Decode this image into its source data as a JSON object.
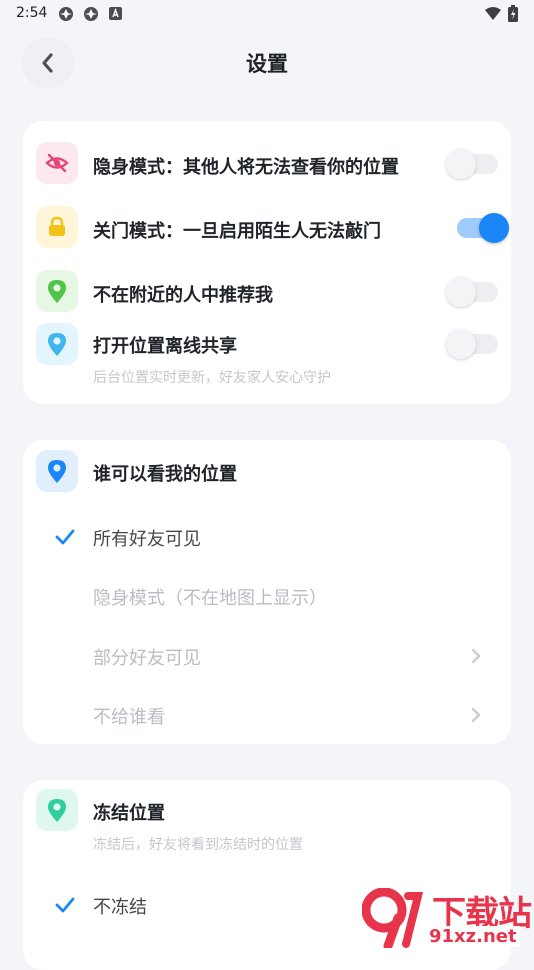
{
  "status_bar": {
    "time": "2:54",
    "icons": [
      "app-icon",
      "app-icon",
      "notification-icon",
      "wifi-icon",
      "battery-icon"
    ]
  },
  "header": {
    "title": "设置",
    "back_icon": "chevron-left-icon"
  },
  "privacy_card": {
    "items": [
      {
        "label": "隐身模式：其他人将无法查看你的位置",
        "icon": "eye-off-icon",
        "icon_color": "#e5457a",
        "icon_bg": "#fde8f0",
        "enabled": false
      },
      {
        "label": "关门模式：一旦启用陌生人无法敲门",
        "icon": "lock-icon",
        "icon_color": "#f2c21b",
        "icon_bg": "#fff6d9",
        "enabled": true
      },
      {
        "label": "不在附近的人中推荐我",
        "icon": "location-pin-icon",
        "icon_color": "#52c44a",
        "icon_bg": "#e6f8e4",
        "enabled": false
      },
      {
        "label": "打开位置离线共享",
        "sublabel": "后台位置实时更新，好友家人安心守护",
        "icon": "location-pin-icon",
        "icon_color": "#3fb6ee",
        "icon_bg": "#e3f5fd",
        "enabled": false
      }
    ]
  },
  "visibility_card": {
    "title": "谁可以看我的位置",
    "icon": "location-pin-icon",
    "icon_color": "#1a86f7",
    "icon_bg": "#e1eefc",
    "options": [
      {
        "label": "所有好友可见",
        "selected": true,
        "has_arrow": false
      },
      {
        "label": "隐身模式（不在地图上显示）",
        "selected": false,
        "has_arrow": false
      },
      {
        "label": "部分好友可见",
        "selected": false,
        "has_arrow": true
      },
      {
        "label": "不给谁看",
        "selected": false,
        "has_arrow": true
      }
    ]
  },
  "freeze_card": {
    "title": "冻结位置",
    "subtitle": "冻结后，好友将看到冻结时的位置",
    "icon": "location-pin-icon",
    "icon_color": "#2fcf9b",
    "icon_bg": "#e0f7ef",
    "options": [
      {
        "label": "不冻结",
        "selected": true
      }
    ]
  },
  "watermark": {
    "top": "下载站",
    "bottom": "91xz.net"
  },
  "colors": {
    "accent": "#1a86f7",
    "background": "#f3f5f8"
  }
}
